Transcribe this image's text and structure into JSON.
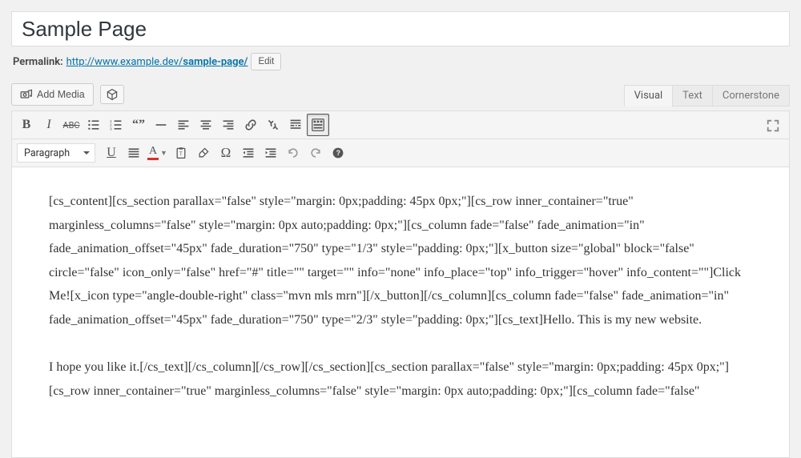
{
  "title": "Sample Page",
  "permalink": {
    "label": "Permalink:",
    "base": "http://www.example.dev/",
    "slug": "sample-page/",
    "edit": "Edit"
  },
  "media": {
    "add_media": "Add Media"
  },
  "tabs": {
    "visual": "Visual",
    "text": "Text",
    "cornerstone": "Cornerstone",
    "active": "visual"
  },
  "format_select": "Paragraph",
  "content": "[cs_content][cs_section parallax=\"false\" style=\"margin: 0px;padding: 45px 0px;\"][cs_row inner_container=\"true\" marginless_columns=\"false\" style=\"margin: 0px auto;padding: 0px;\"][cs_column fade=\"false\" fade_animation=\"in\" fade_animation_offset=\"45px\" fade_duration=\"750\" type=\"1/3\" style=\"padding: 0px;\"][x_button size=\"global\" block=\"false\" circle=\"false\" icon_only=\"false\" href=\"#\" title=\"\" target=\"\" info=\"none\" info_place=\"top\" info_trigger=\"hover\" info_content=\"\"]Click Me![x_icon type=\"angle-double-right\" class=\"mvn mls mrn\"][/x_button][/cs_column][cs_column fade=\"false\" fade_animation=\"in\" fade_animation_offset=\"45px\" fade_duration=\"750\" type=\"2/3\" style=\"padding: 0px;\"][cs_text]Hello. This is my new website.\n\nI hope you like it.[/cs_text][/cs_column][/cs_row][/cs_section][cs_section parallax=\"false\" style=\"margin: 0px;padding: 45px 0px;\"][cs_row inner_container=\"true\" marginless_columns=\"false\" style=\"margin: 0px auto;padding: 0px;\"][cs_column fade=\"false\""
}
